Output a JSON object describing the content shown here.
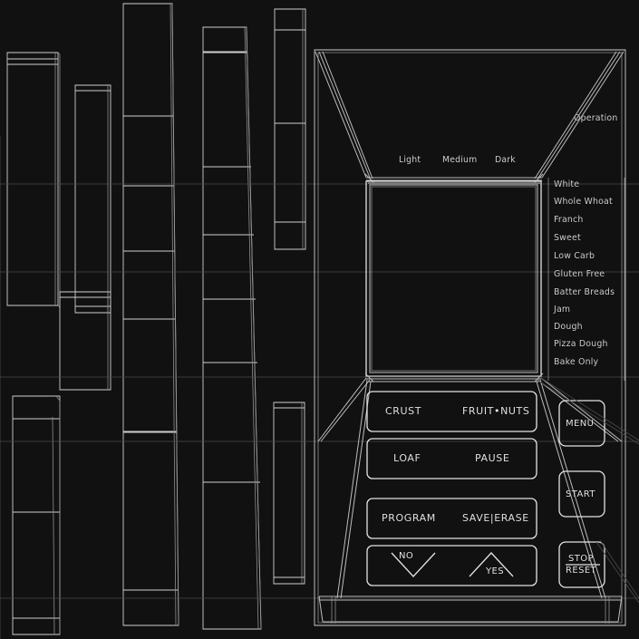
{
  "viewport": {
    "background_color": "#111111",
    "wire_color": "#d0d0d0",
    "wire_color_dim": "#5a5a5a",
    "title": "Bread Machine Control Panel Wireframe"
  },
  "panel": {
    "operation_label": "Operation",
    "crust_levels": [
      "Light",
      "Medium",
      "Dark"
    ],
    "menu_programs": [
      "White",
      "Whole Whoat",
      "Franch",
      "Sweet",
      "Low Carb",
      "Gluten Free",
      "Batter Breads",
      "Jam",
      "Dough",
      "Pizza Dough",
      "Bake Only"
    ],
    "button_rows": [
      {
        "left": "CRUST",
        "right": "FRUIT•NUTS"
      },
      {
        "left": "LOAF",
        "right": "PAUSE"
      },
      {
        "left": "PROGRAM",
        "right": "SAVE|ERASE"
      }
    ],
    "arrow_row": {
      "left": "NO",
      "right": "YES"
    },
    "side_buttons": [
      {
        "label": "MENU"
      },
      {
        "label": "START"
      },
      {
        "label_line1": "STOP",
        "label_line2": "RESET"
      }
    ]
  },
  "wireframe_panels": {
    "count": 8,
    "description": "vertical extruded box outlines"
  }
}
